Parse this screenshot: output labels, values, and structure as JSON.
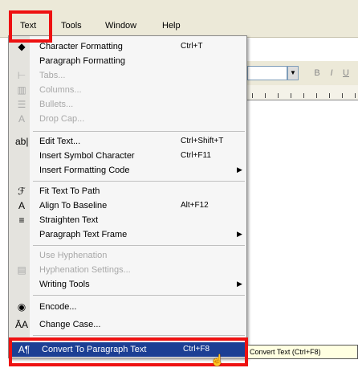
{
  "menubar": {
    "items": [
      "Text",
      "Tools",
      "Window",
      "Help"
    ]
  },
  "menu": {
    "items": [
      {
        "label": "Character Formatting",
        "shortcut": "Ctrl+T",
        "icon": "character-format-icon",
        "disabled": false
      },
      {
        "label": "Paragraph Formatting",
        "shortcut": "",
        "icon": "",
        "disabled": false
      },
      {
        "label": "Tabs...",
        "shortcut": "",
        "icon": "tabs-icon",
        "disabled": true
      },
      {
        "label": "Columns...",
        "shortcut": "",
        "icon": "columns-icon",
        "disabled": true
      },
      {
        "label": "Bullets...",
        "shortcut": "",
        "icon": "bullets-icon",
        "disabled": true
      },
      {
        "label": "Drop Cap...",
        "shortcut": "",
        "icon": "drop-cap-icon",
        "disabled": true
      },
      {
        "label": "Edit Text...",
        "shortcut": "Ctrl+Shift+T",
        "icon": "edit-text-icon",
        "disabled": false
      },
      {
        "label": "Insert Symbol Character",
        "shortcut": "Ctrl+F11",
        "icon": "",
        "disabled": false
      },
      {
        "label": "Insert Formatting Code",
        "shortcut": "",
        "icon": "",
        "disabled": false,
        "submenu": true
      },
      {
        "label": "Fit Text To Path",
        "shortcut": "",
        "icon": "fit-text-path-icon",
        "disabled": false
      },
      {
        "label": "Align To Baseline",
        "shortcut": "Alt+F12",
        "icon": "align-baseline-icon",
        "disabled": false
      },
      {
        "label": "Straighten Text",
        "shortcut": "",
        "icon": "straighten-text-icon",
        "disabled": false
      },
      {
        "label": "Paragraph Text Frame",
        "shortcut": "",
        "icon": "",
        "disabled": false,
        "submenu": true
      },
      {
        "label": "Use Hyphenation",
        "shortcut": "",
        "icon": "",
        "disabled": true
      },
      {
        "label": "Hyphenation Settings...",
        "shortcut": "",
        "icon": "hyphenation-icon",
        "disabled": true
      },
      {
        "label": "Writing Tools",
        "shortcut": "",
        "icon": "",
        "disabled": false,
        "submenu": true
      },
      {
        "label": "Encode...",
        "shortcut": "",
        "icon": "encode-icon",
        "disabled": false
      },
      {
        "label": "Change Case...",
        "shortcut": "",
        "icon": "change-case-icon",
        "disabled": false
      },
      {
        "label": "Convert To Paragraph Text",
        "shortcut": "Ctrl+F8",
        "icon": "convert-text-icon",
        "disabled": false,
        "highlighted": true
      }
    ]
  },
  "tooltip": "Convert Text (Ctrl+F8)",
  "colors": {
    "highlight": "#1c3f94",
    "annotation": "#ee1111",
    "menu_bg": "#f6f6f6",
    "gutter": "#e4e3de"
  }
}
